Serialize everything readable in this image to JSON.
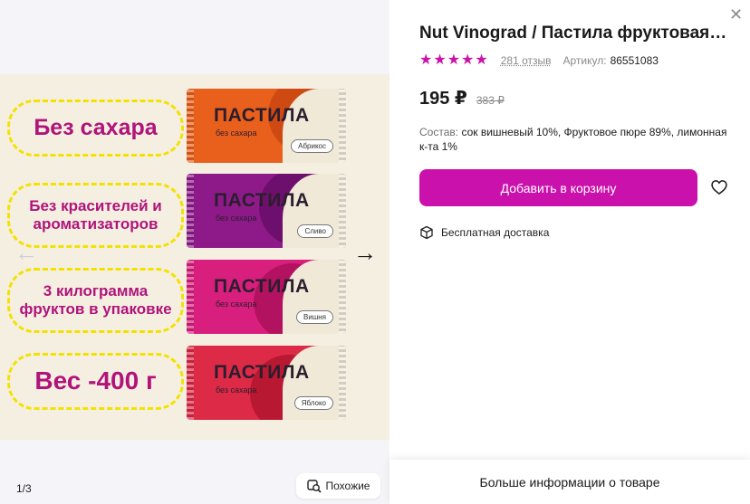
{
  "gallery": {
    "claims": [
      "Без сахара",
      "Без красителей и ароматизаторов",
      "3 килограмма фруктов в упаковке",
      "Вес -400 г"
    ],
    "bars": [
      {
        "brand": "ПАСТИЛА",
        "sub": "без сахара",
        "flavor": "Абрикос",
        "color": "#e9601c"
      },
      {
        "brand": "ПАСТИЛА",
        "sub": "без сахара",
        "flavor": "Сливо",
        "color": "#8e1a8a"
      },
      {
        "brand": "ПАСТИЛА",
        "sub": "без сахара",
        "flavor": "Вишня",
        "color": "#d81f7d"
      },
      {
        "brand": "ПАСТИЛА",
        "sub": "без сахара",
        "flavor": "Яблоко",
        "color": "#dc2a47"
      }
    ],
    "counter": "1/3",
    "similar_label": "Похожие"
  },
  "product": {
    "title": "Nut Vinograd / Пастила фруктовая без сахара",
    "rating_stars": 5,
    "reviews": "281 отзыв",
    "article_label": "Артикул:",
    "article_value": "86551083",
    "price": "195 ₽",
    "old_price": "383 ₽",
    "composition_label": "Состав:",
    "composition_value": "сок вишневый 10%, Фруктовое пюре 89%, лимонная к-та 1%",
    "cart_button": "Добавить в корзину",
    "delivery": "Бесплатная доставка",
    "more_info": "Больше информации о товаре"
  },
  "colors": {
    "accent": "#cb11ab",
    "claim_text": "#b0147a",
    "claim_border": "#f3e200"
  },
  "icons": [
    "close-icon",
    "star-icon",
    "heart-icon",
    "box-icon",
    "similar-search-icon",
    "arrow-left-icon",
    "arrow-right-icon"
  ]
}
